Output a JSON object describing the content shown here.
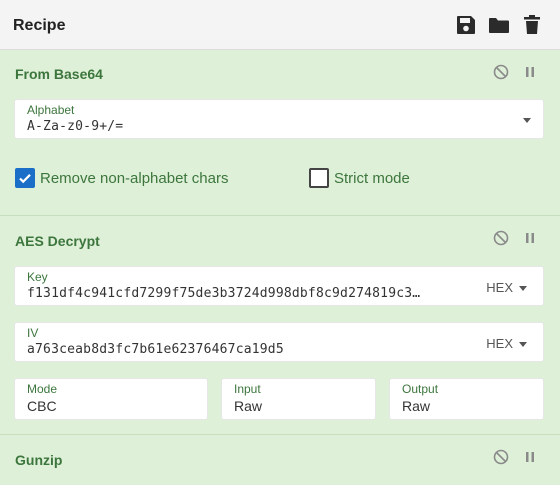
{
  "header": {
    "title": "Recipe",
    "icons": [
      "save-icon",
      "folder-icon",
      "trash-icon"
    ]
  },
  "operations": {
    "from_base64": {
      "title": "From Base64",
      "alphabet_label": "Alphabet",
      "alphabet_value": "A-Za-z0-9+/=",
      "remove_non_alphabet_label": "Remove non-alphabet chars",
      "remove_non_alphabet_checked": true,
      "strict_mode_label": "Strict mode",
      "strict_mode_checked": false
    },
    "aes_decrypt": {
      "title": "AES Decrypt",
      "key_label": "Key",
      "key_value": "f131df4c941cfd7299f75de3b3724d998dbf8c9d274819c3…",
      "key_format": "HEX",
      "iv_label": "IV",
      "iv_value": "a763ceab8d3fc7b61e62376467ca19d5",
      "iv_format": "HEX",
      "mode_label": "Mode",
      "mode_value": "CBC",
      "input_label": "Input",
      "input_value": "Raw",
      "output_label": "Output",
      "output_value": "Raw"
    },
    "gunzip": {
      "title": "Gunzip"
    }
  },
  "colors": {
    "op_background": "#dff0d8",
    "op_title": "#3c763d",
    "checkbox_on": "#1a6ec7"
  }
}
